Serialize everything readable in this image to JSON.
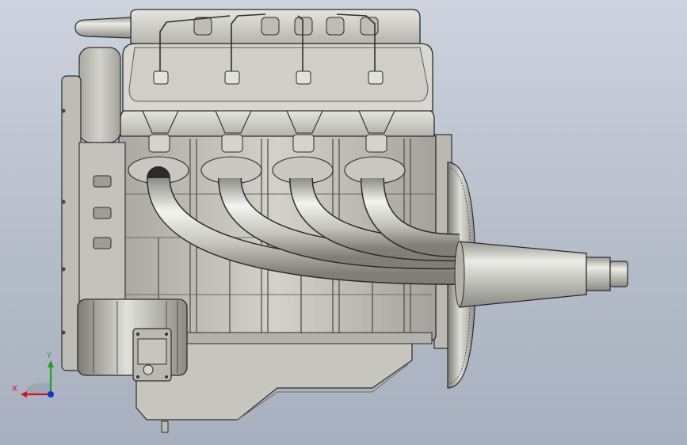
{
  "view": {
    "background_top": "#cdd3de",
    "background_bottom": "#a8b0bf",
    "model_fill": "#c9c9c2",
    "model_shade": "#9d9d96",
    "model_highlight": "#eeeeea",
    "edge_color": "#2b2b2b",
    "description_model": "inline-four-engine"
  },
  "triad": {
    "x_label": "X",
    "y_label": "Y",
    "x_color": "#d0141a",
    "y_color": "#1ca21c",
    "z_color": "#1530d6"
  }
}
